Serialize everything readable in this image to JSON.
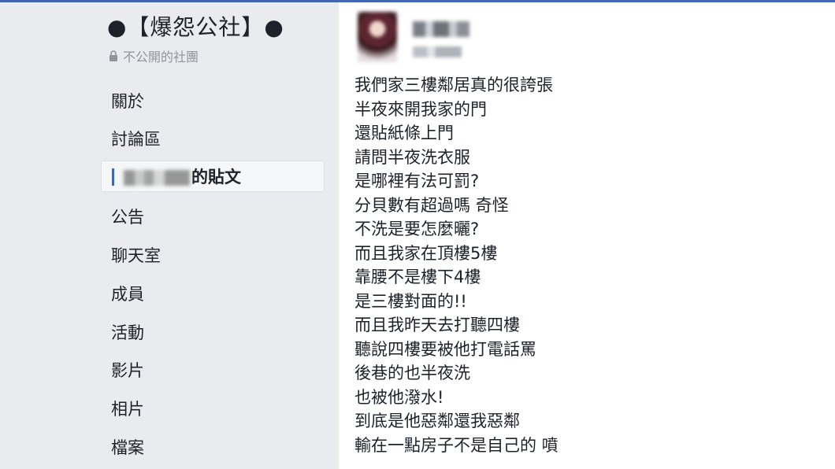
{
  "group": {
    "title": "●【爆怨公社】●",
    "privacy": "不公開的社團"
  },
  "nav": {
    "items": [
      "關於",
      "討論區",
      "的貼文",
      "公告",
      "聊天室",
      "成員",
      "活動",
      "影片",
      "相片",
      "檔案"
    ],
    "active_index": 2
  },
  "post": {
    "lines": [
      "我們家三樓鄰居真的很誇張",
      "半夜來開我家的門",
      "還貼紙條上門",
      "請問半夜洗衣服",
      "是哪裡有法可罰?",
      "分貝數有超過嗎 奇怪",
      "不洗是要怎麼曬?",
      "而且我家在頂樓5樓",
      "靠腰不是樓下4樓",
      "是三樓對面的!!",
      "而且我昨天去打聽四樓",
      "聽說四樓要被他打電話罵",
      "後巷的也半夜洗",
      "也被他潑水!",
      "到底是他惡鄰還我惡鄰",
      "輸在一點房子不是自己的 噴"
    ]
  },
  "colors": {
    "sidebar_bg": "#e9ebee",
    "accent": "#4267b2",
    "muted_text": "#90949c"
  },
  "icons": {
    "privacy": "lock-icon"
  }
}
